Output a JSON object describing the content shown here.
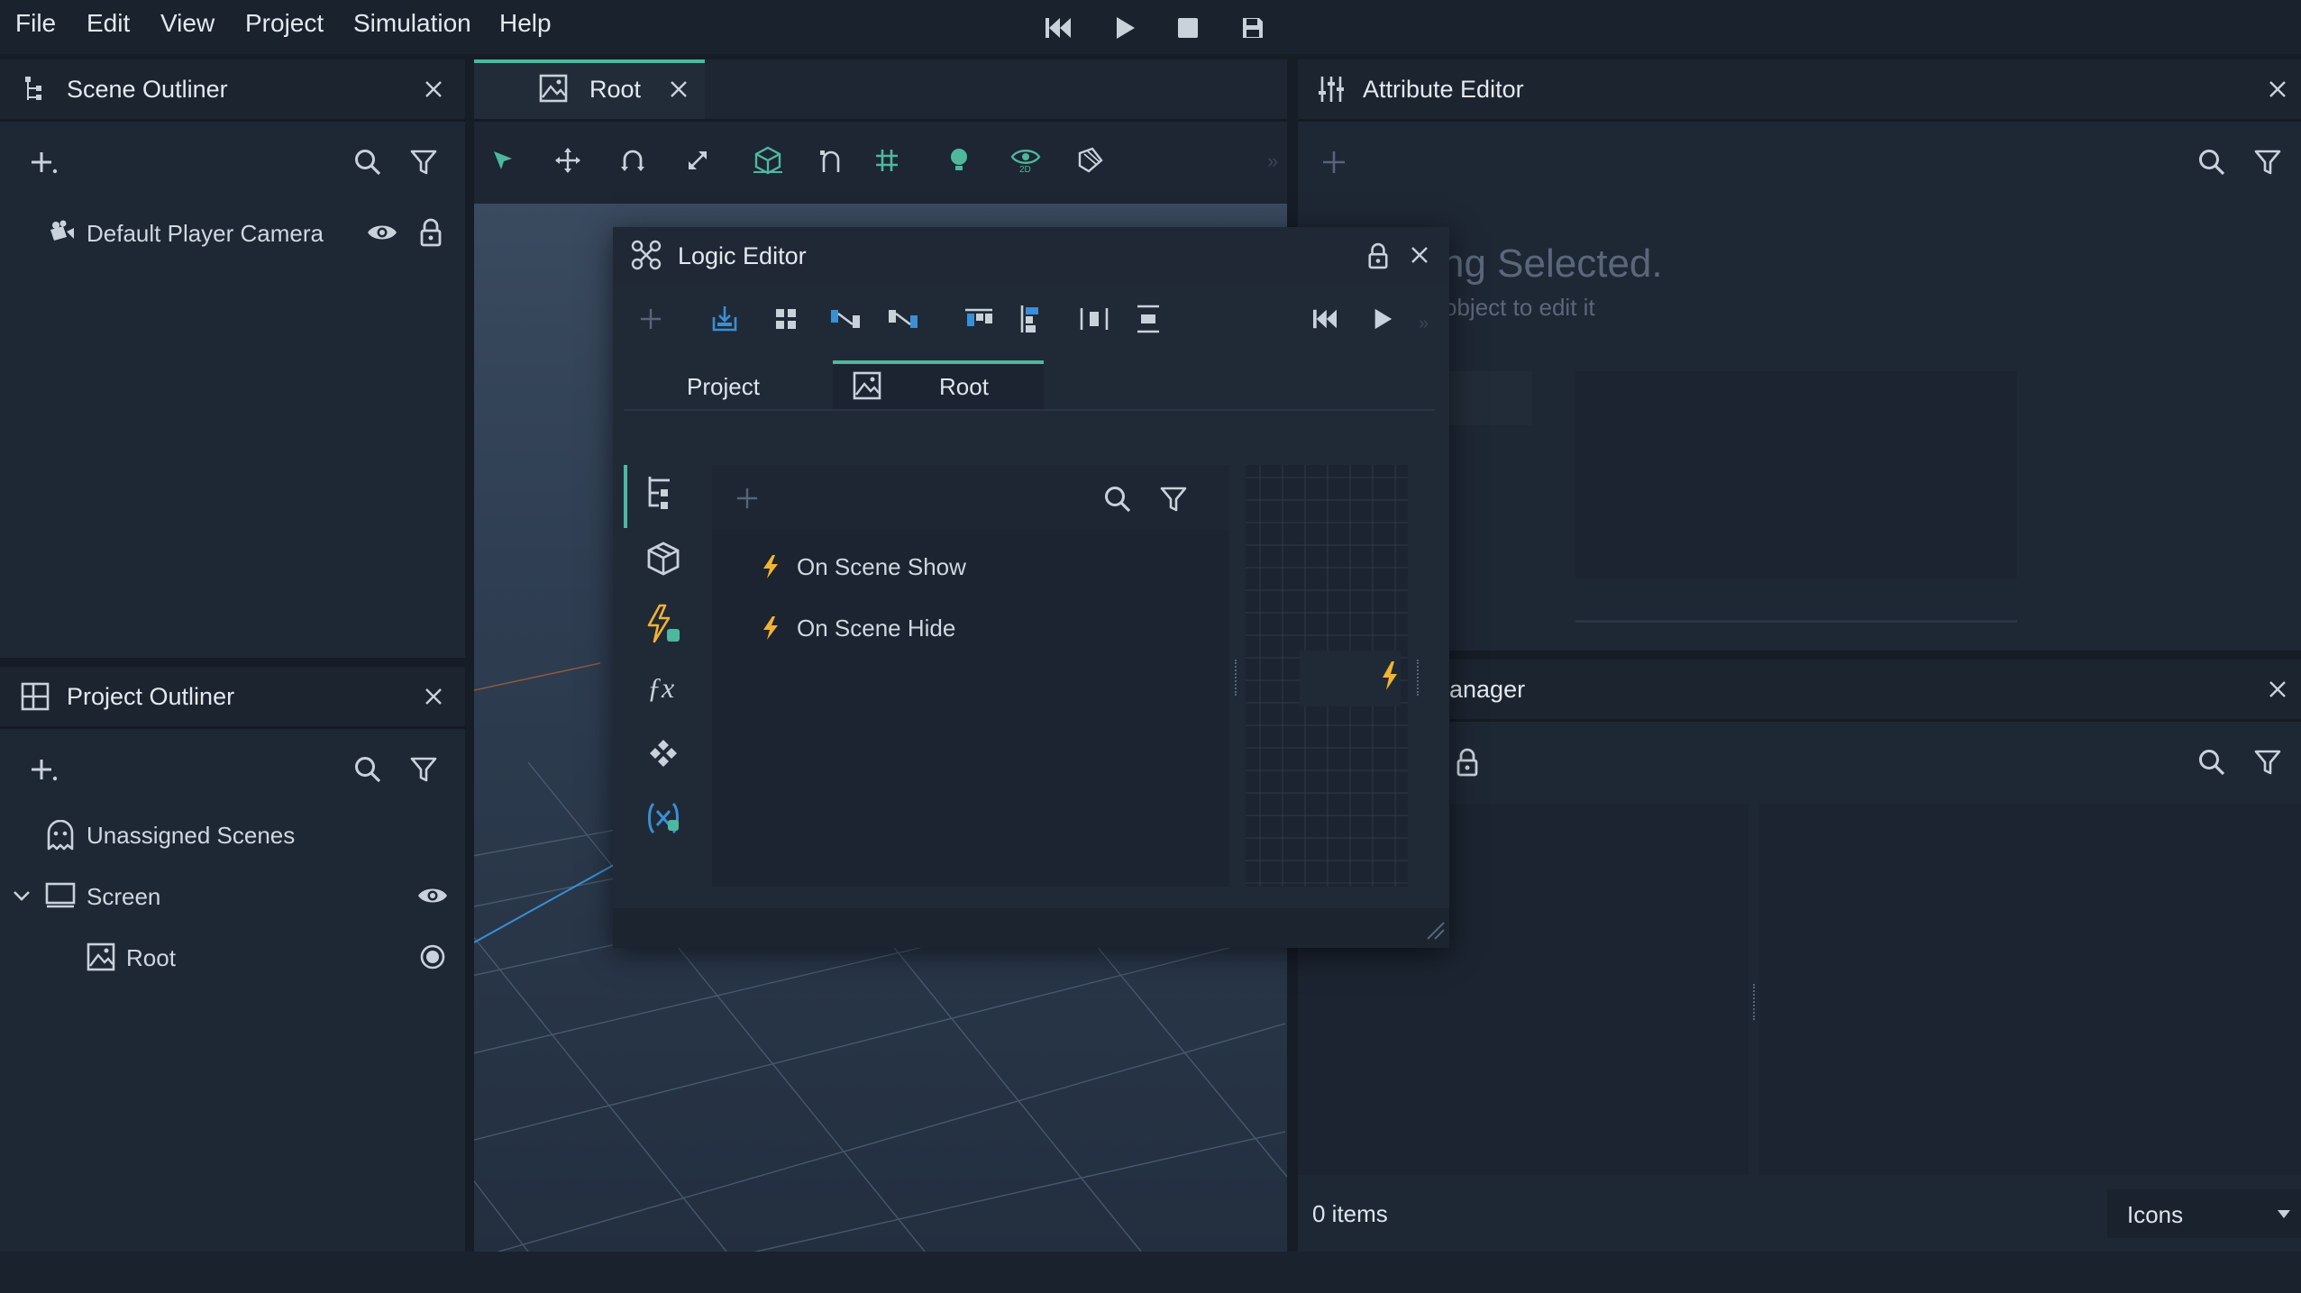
{
  "menubar": {
    "items": [
      "File",
      "Edit",
      "View",
      "Project",
      "Simulation",
      "Help"
    ],
    "controls": {
      "rewind_icon": "rewind-icon",
      "play_icon": "play-icon",
      "stop_icon": "stop-icon",
      "save_icon": "save-icon"
    }
  },
  "scene_outliner": {
    "title": "Scene Outliner",
    "items": [
      {
        "label": "Default Player Camera",
        "icon": "camera-icon",
        "visible": true,
        "locked": true
      }
    ]
  },
  "project_outliner": {
    "title": "Project Outliner",
    "items": [
      {
        "label": "Unassigned Scenes",
        "icon": "ghost-icon"
      },
      {
        "label": "Screen",
        "icon": "monitor-icon",
        "expanded": true
      },
      {
        "label": "Root",
        "icon": "scene-image-icon",
        "active": true
      }
    ]
  },
  "viewport": {
    "tab_label": "Root",
    "toolbar": [
      "select-arrow-icon",
      "move-icon",
      "rotate-icon",
      "scale-icon",
      "cube-view-icon",
      "snap-icon",
      "grid-icon",
      "light-bulb-icon",
      "eye-2d-icon",
      "texture-icon"
    ]
  },
  "attribute_editor": {
    "title": "Attribute Editor",
    "empty_title": "ng Selected.",
    "empty_hint": "object to edit it"
  },
  "asset_manager": {
    "title": "anager",
    "status": "0 items",
    "view_mode": "Icons"
  },
  "logic_editor": {
    "title": "Logic Editor",
    "tabs": [
      {
        "label": "Project",
        "active": false
      },
      {
        "label": "Root",
        "active": true
      }
    ],
    "events": [
      {
        "label": "On Scene Show"
      },
      {
        "label": "On Scene Hide"
      }
    ]
  },
  "colors": {
    "accent": "#4db89e",
    "event_orange": "#f2b233",
    "variable_blue": "#3a8fd6",
    "background": "#161d27",
    "panel": "#1e2734"
  }
}
